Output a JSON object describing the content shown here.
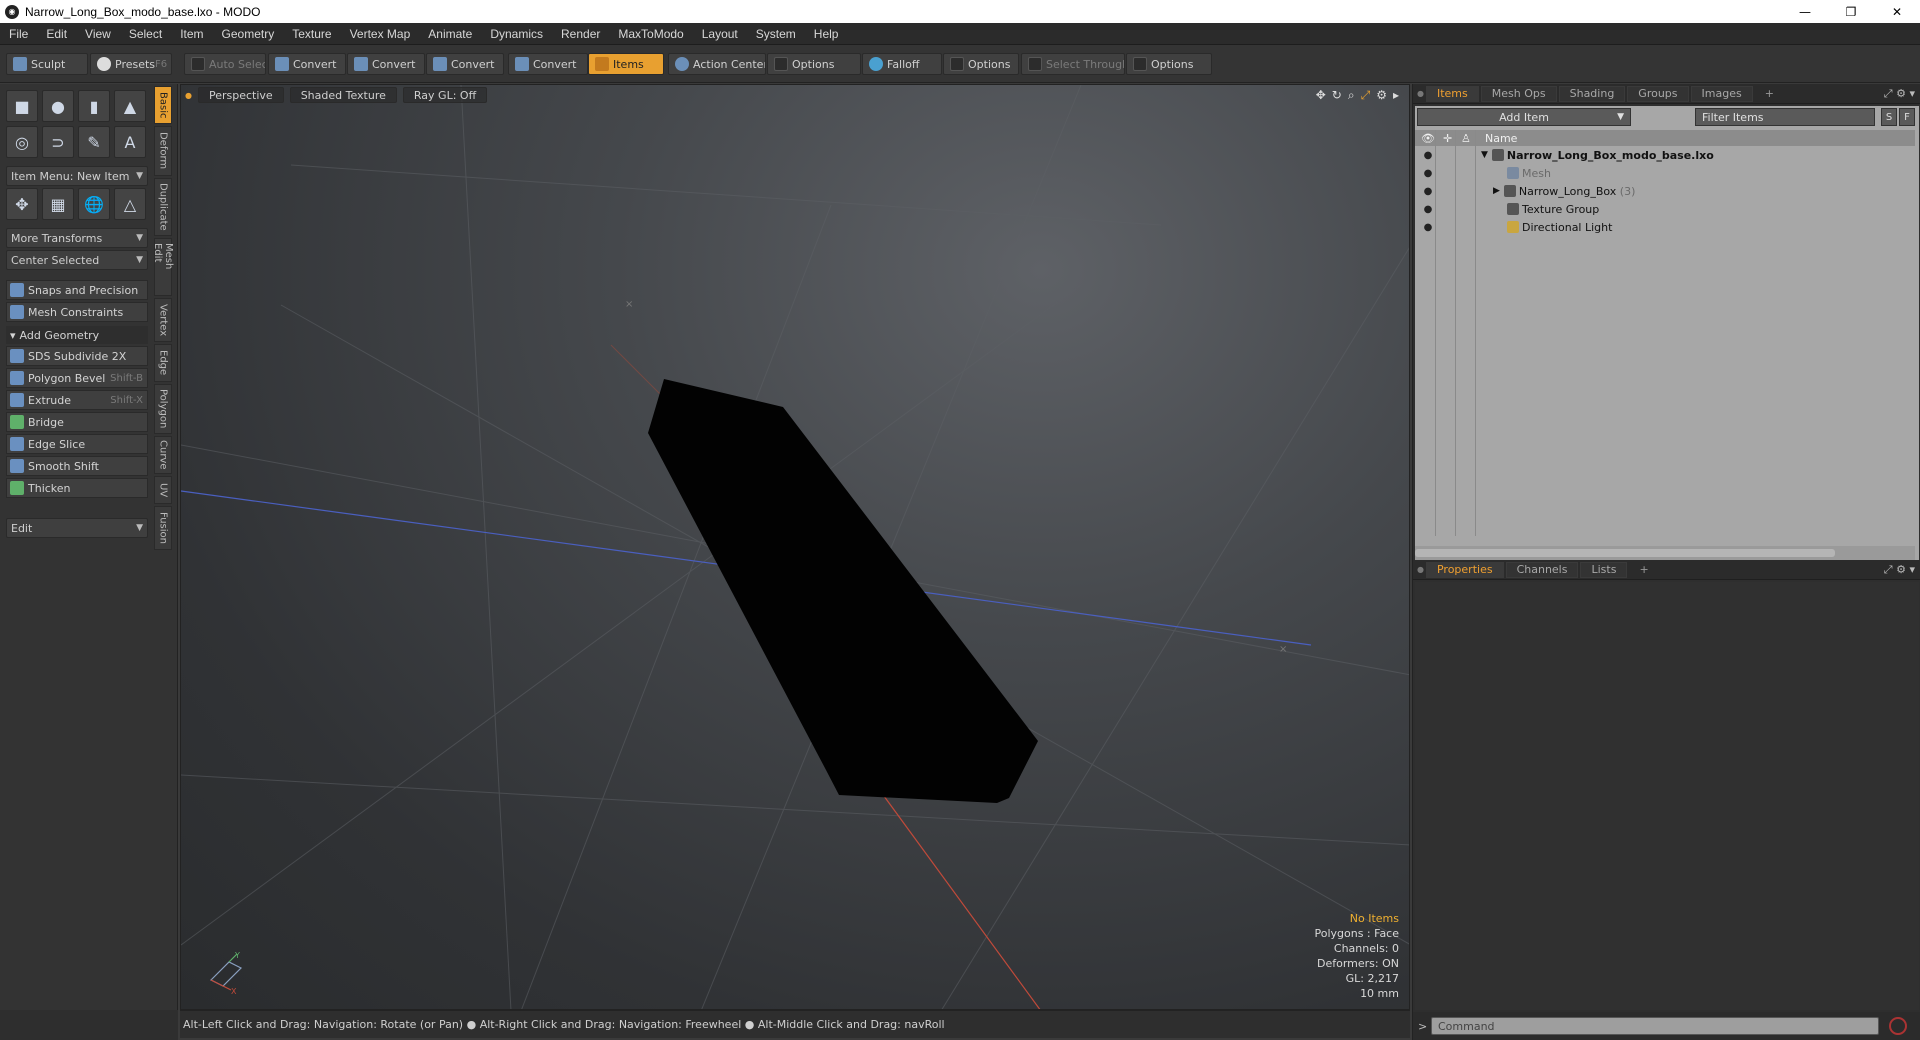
{
  "window": {
    "title": "Narrow_Long_Box_modo_base.lxo - MODO",
    "minimize": "—",
    "restore": "❐",
    "close": "✕"
  },
  "menu": [
    "File",
    "Edit",
    "View",
    "Select",
    "Item",
    "Geometry",
    "Texture",
    "Vertex Map",
    "Animate",
    "Dynamics",
    "Render",
    "MaxToModo",
    "Layout",
    "System",
    "Help"
  ],
  "toolbar": {
    "sculpt": "Sculpt",
    "presets": "Presets",
    "presets_key": "F6",
    "auto_select": "Auto Select",
    "convert1": "Convert",
    "convert2": "Convert",
    "convert3": "Convert",
    "convert4": "Convert",
    "items": "Items",
    "action_center": "Action Center",
    "options1": "Options",
    "falloff": "Falloff",
    "options2": "Options",
    "select_through": "Select Through",
    "options3": "Options"
  },
  "left_panel": {
    "item_menu": "Item Menu: New Item",
    "more_transforms": "More Transforms",
    "center_selected": "Center Selected",
    "snaps": "Snaps and Precision",
    "mesh_constraints": "Mesh Constraints",
    "add_geometry": "Add Geometry",
    "tools": [
      {
        "label": "SDS Subdivide 2X",
        "shortcut": ""
      },
      {
        "label": "Polygon Bevel",
        "shortcut": "Shift-B"
      },
      {
        "label": "Extrude",
        "shortcut": "Shift-X"
      },
      {
        "label": "Bridge",
        "shortcut": ""
      },
      {
        "label": "Edge Slice",
        "shortcut": ""
      },
      {
        "label": "Smooth Shift",
        "shortcut": ""
      },
      {
        "label": "Thicken",
        "shortcut": ""
      }
    ],
    "edit": "Edit",
    "vertical_tabs": [
      "Basic",
      "Deform",
      "Duplicate",
      "Mesh Edit",
      "Vertex",
      "Edge",
      "Polygon",
      "Curve",
      "UV",
      "Fusion"
    ]
  },
  "viewport": {
    "tabs": [
      "Perspective",
      "Shaded Texture",
      "Ray GL: Off"
    ],
    "stats": {
      "no_items": "No Items",
      "polygons": "Polygons : Face",
      "channels": "Channels: 0",
      "deformers": "Deformers: ON",
      "gl": "GL: 2,217",
      "scale": "10 mm"
    }
  },
  "status_bar": "Alt-Left Click and Drag: Navigation: Rotate (or Pan) ● Alt-Right Click and Drag: Navigation: Freewheel ● Alt-Middle Click and Drag: navRoll",
  "items_panel": {
    "tabs": [
      "Items",
      "Mesh Ops",
      "Shading",
      "Groups",
      "Images"
    ],
    "add_item": "Add Item",
    "filter": "Filter Items",
    "s_btn": "S",
    "f_btn": "F",
    "name_header": "Name",
    "rows": [
      {
        "label": "Narrow_Long_Box_modo_base.lxo",
        "count": ""
      },
      {
        "label": "Mesh",
        "count": ""
      },
      {
        "label": "Narrow_Long_Box",
        "count": "(3)"
      },
      {
        "label": "Texture Group",
        "count": ""
      },
      {
        "label": "Directional Light",
        "count": ""
      }
    ]
  },
  "properties_panel": {
    "tabs": [
      "Properties",
      "Channels",
      "Lists"
    ]
  },
  "command": {
    "placeholder": "Command"
  }
}
